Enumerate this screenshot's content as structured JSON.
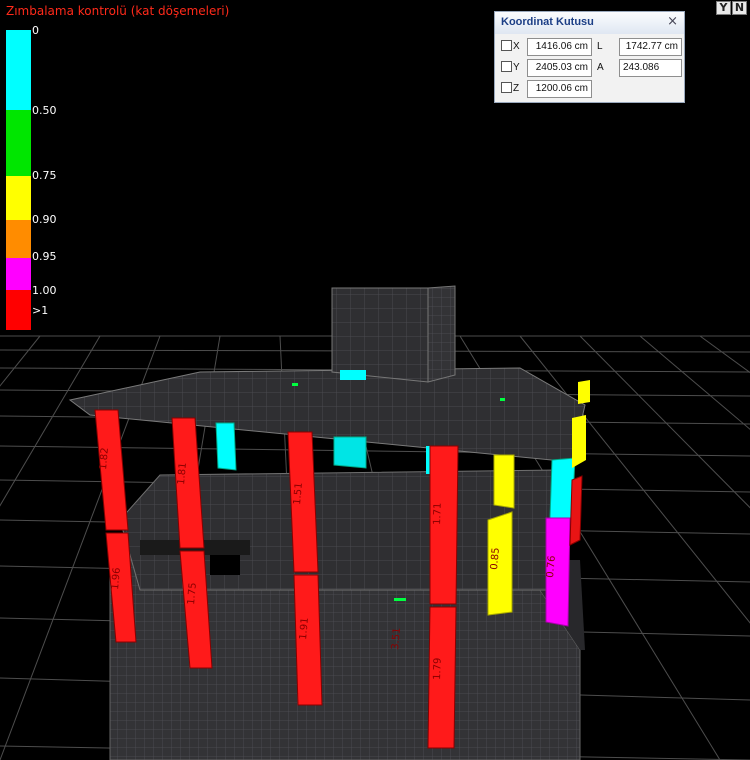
{
  "view": {
    "title": "Zımbalama kontrolü (kat döşemeleri)",
    "title_color": "#ff2a1a",
    "background": "#000000"
  },
  "legend": {
    "items": [
      {
        "label": "0",
        "color": "#00ffff"
      },
      {
        "label": "0.50",
        "color": "#00e600"
      },
      {
        "label": "0.75",
        "color": "#ffff00"
      },
      {
        "label": "0.90",
        "color": "#ff8c00"
      },
      {
        "label": "0.95",
        "color": "#ff00ff"
      },
      {
        "label": "1.00",
        "color": "#ff0000"
      },
      {
        "label": ">1",
        "color": "#ff0000"
      }
    ]
  },
  "toolbar": {
    "filter_icon": "filter-icon",
    "filter_label": "Y",
    "n_label": "N"
  },
  "coord_box": {
    "title": "Koordinat Kutusu",
    "close_icon": "close-icon",
    "close_glyph": "×",
    "x_label": "X",
    "x_value": "1416.06 cm",
    "y_label": "Y",
    "y_value": "2405.03 cm",
    "z_label": "Z",
    "z_value": "1200.06 cm",
    "l_label": "L",
    "l_value": "1742.77 cm",
    "a_label": "A",
    "a_value": "243.086"
  },
  "column_labels": {
    "col1_top": "1.82",
    "col1_bot": "1.96",
    "col2_top": "1.81",
    "col2_bot": "1.75",
    "col3_top": "1.51",
    "col3_bot": "1.91",
    "col4_top": "1.71",
    "col4_bot": "1.79",
    "floor_value": "3.51",
    "yellow_value": "0.85",
    "magenta_value": "0.76"
  }
}
